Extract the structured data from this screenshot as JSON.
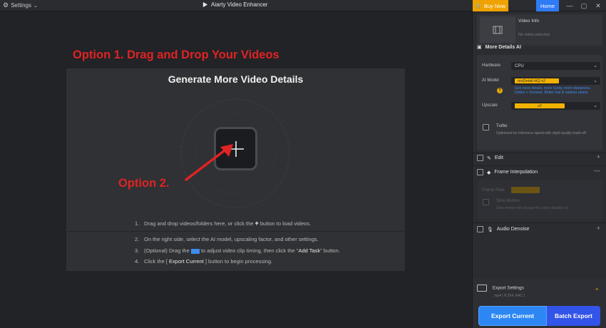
{
  "titlebar": {
    "settings_label": "Settings",
    "app_title": "Aiarty Video Enhancer",
    "buy_now": "Buy Now",
    "home": "Home"
  },
  "main": {
    "annotation_option1": "Option 1. Drag and Drop Your Videos",
    "annotation_option2": "Option 2.",
    "panel_title": "Generate More Video Details",
    "steps": [
      {
        "num": "1.",
        "text_a": "Drag and drop videos/folders here, or click the ",
        "text_b": " button to load videos."
      },
      {
        "num": "2.",
        "text": "On the right side, select the AI model, upscaling factor, and other settings."
      },
      {
        "num": "3.",
        "text_a": "(Optional) Drag the ",
        "text_b": " to adjust video clip timing, then click the \"",
        "bold": "Add Task",
        "text_c": "\" button."
      },
      {
        "num": "4.",
        "text_a": "Click the [ ",
        "bold": "Export Current",
        "text_b": " ] button to begin processing."
      }
    ]
  },
  "sidebar": {
    "video_info_title": "Video Info",
    "video_info_sub": "No video selected",
    "more_details": "More Details AI",
    "hardware_label": "Hardware",
    "hardware_value": "CPU",
    "ai_model_label": "AI Model",
    "ai_model_value": "moDetail-HQ  v2",
    "ai_model_hint": "Gen more details, more clarity, more sharpness. Deblur + Denoise. Better hair & outdoor plants.",
    "upscale_label": "Upscale",
    "upscale_value": "x2",
    "turbo_label": "Turbo",
    "turbo_desc": "Optimized for inference speed with slight quality trade-off",
    "edit_label": "Edit",
    "frame_interp_label": "Frame Interpolation",
    "frame_rate_label": "Frame Rate",
    "slow_motion_label": "Slow Motion",
    "slow_motion_desc": "Slow motion will change the video duration x2",
    "audio_denoise_label": "Audio Denoise",
    "export_settings": "Export Settings",
    "export_sub": "mp4 [ H.264, AAC ]",
    "export_current": "Export Current",
    "batch_export": "Batch Export"
  },
  "colors": {
    "annotation_red": "#e02323",
    "buy_now": "#f0a202",
    "home": "#2f7bf6",
    "accent_yellow": "#f2b200",
    "export_blue": "#2c87f5",
    "batch_blue": "#3354e8"
  }
}
